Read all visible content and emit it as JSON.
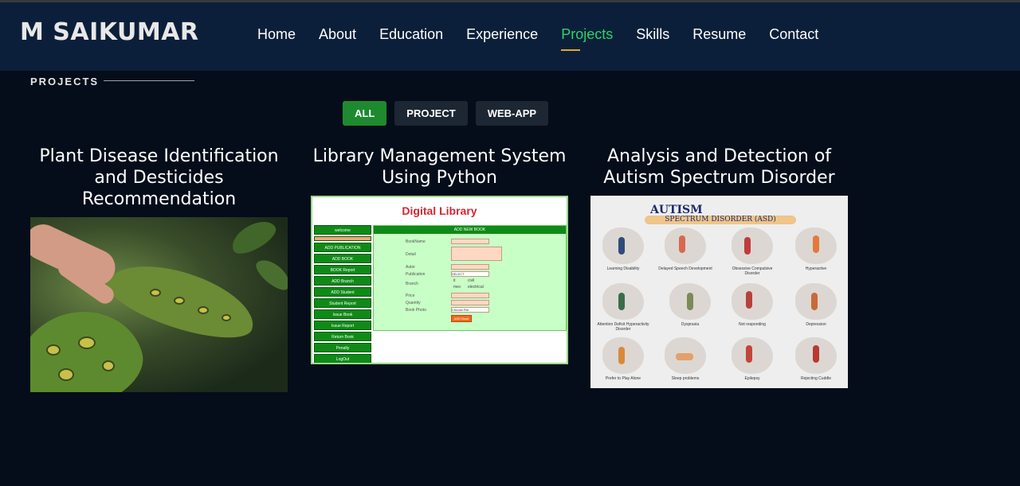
{
  "header": {
    "brand": "M SAIKUMAR",
    "nav": [
      {
        "label": "Home",
        "active": false
      },
      {
        "label": "About",
        "active": false
      },
      {
        "label": "Education",
        "active": false
      },
      {
        "label": "Experience",
        "active": false
      },
      {
        "label": "Projects",
        "active": true
      },
      {
        "label": "Skills",
        "active": false
      },
      {
        "label": "Resume",
        "active": false
      },
      {
        "label": "Contact",
        "active": false
      }
    ]
  },
  "section": {
    "label": "PROJECTS"
  },
  "filters": [
    {
      "label": "ALL",
      "active": true
    },
    {
      "label": "PROJECT",
      "active": false
    },
    {
      "label": "WEB-APP",
      "active": false
    }
  ],
  "projects": [
    {
      "title_lines": [
        "Plant Disease Identification",
        "and Desticides",
        "Recommendation"
      ]
    },
    {
      "title_lines": [
        "Library Management System",
        "Using Python"
      ],
      "screenshot": {
        "logo": "Digital Library",
        "menu": [
          "welcome",
          "",
          "ADD PUBLICATION",
          "ADD BOOK",
          "BOOK Report",
          "ADD Branch",
          "ADD Student",
          "Student Report",
          "Issue Book",
          "Issue Report",
          "Return Book",
          "Penalty",
          "LogOut"
        ],
        "panel_title": "ADD NEW BOOK",
        "fields": [
          "BookName",
          "Detail",
          "Autor",
          "Publication",
          "Branch",
          "Price",
          "Quantity",
          "Book Photo"
        ],
        "publication_value": "SELECT",
        "branch_options": [
          "it",
          "civil",
          "mec",
          "electrical"
        ],
        "file_button": "Choose File",
        "submit": "ADD Book"
      }
    },
    {
      "title_lines": [
        "Analysis and Detection of",
        "Autism Spectrum Disorder"
      ],
      "infographic": {
        "title": "AUTISM",
        "subtitle": "SPECTRUM DISORDER (ASD)",
        "captions": [
          "Learning Disability",
          "Delayed Speech Development",
          "Obsessive Compulsive Disorder",
          "Hyperactive",
          "Attention Deficit Hyperactivity Disorder",
          "Dyspraxia",
          "Not responding",
          "Depression",
          "Prefer to Play Alone",
          "Sleep problems",
          "Epilepsy",
          "Rejecting Cuddle"
        ]
      }
    }
  ],
  "colors": {
    "accent": "#2bd46a",
    "underline": "#e0a82e",
    "filter_active": "#1e8a2f",
    "header_bg": "#0c1f3a",
    "page_bg": "#040d19"
  }
}
